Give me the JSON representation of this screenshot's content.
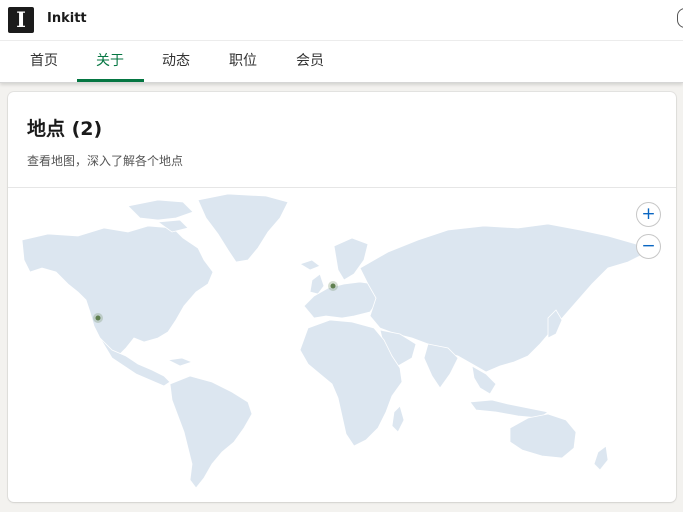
{
  "company": {
    "name": "Inkitt",
    "logo_letter": "I"
  },
  "tabs": [
    {
      "label": "首页",
      "active": false
    },
    {
      "label": "关于",
      "active": true
    },
    {
      "label": "动态",
      "active": false
    },
    {
      "label": "职位",
      "active": false
    },
    {
      "label": "会员",
      "active": false
    }
  ],
  "locations": {
    "title": "地点 (2)",
    "subtitle": "查看地图，深入了解各个地点",
    "zoom_in": "+",
    "zoom_out": "−"
  },
  "colors": {
    "accent": "#057642",
    "land": "#dce6f0",
    "marker": "#5f7f4f",
    "zoom": "#0a66c2"
  },
  "icons": {
    "zoom_in": "plus-icon",
    "zoom_out": "minus-icon"
  }
}
